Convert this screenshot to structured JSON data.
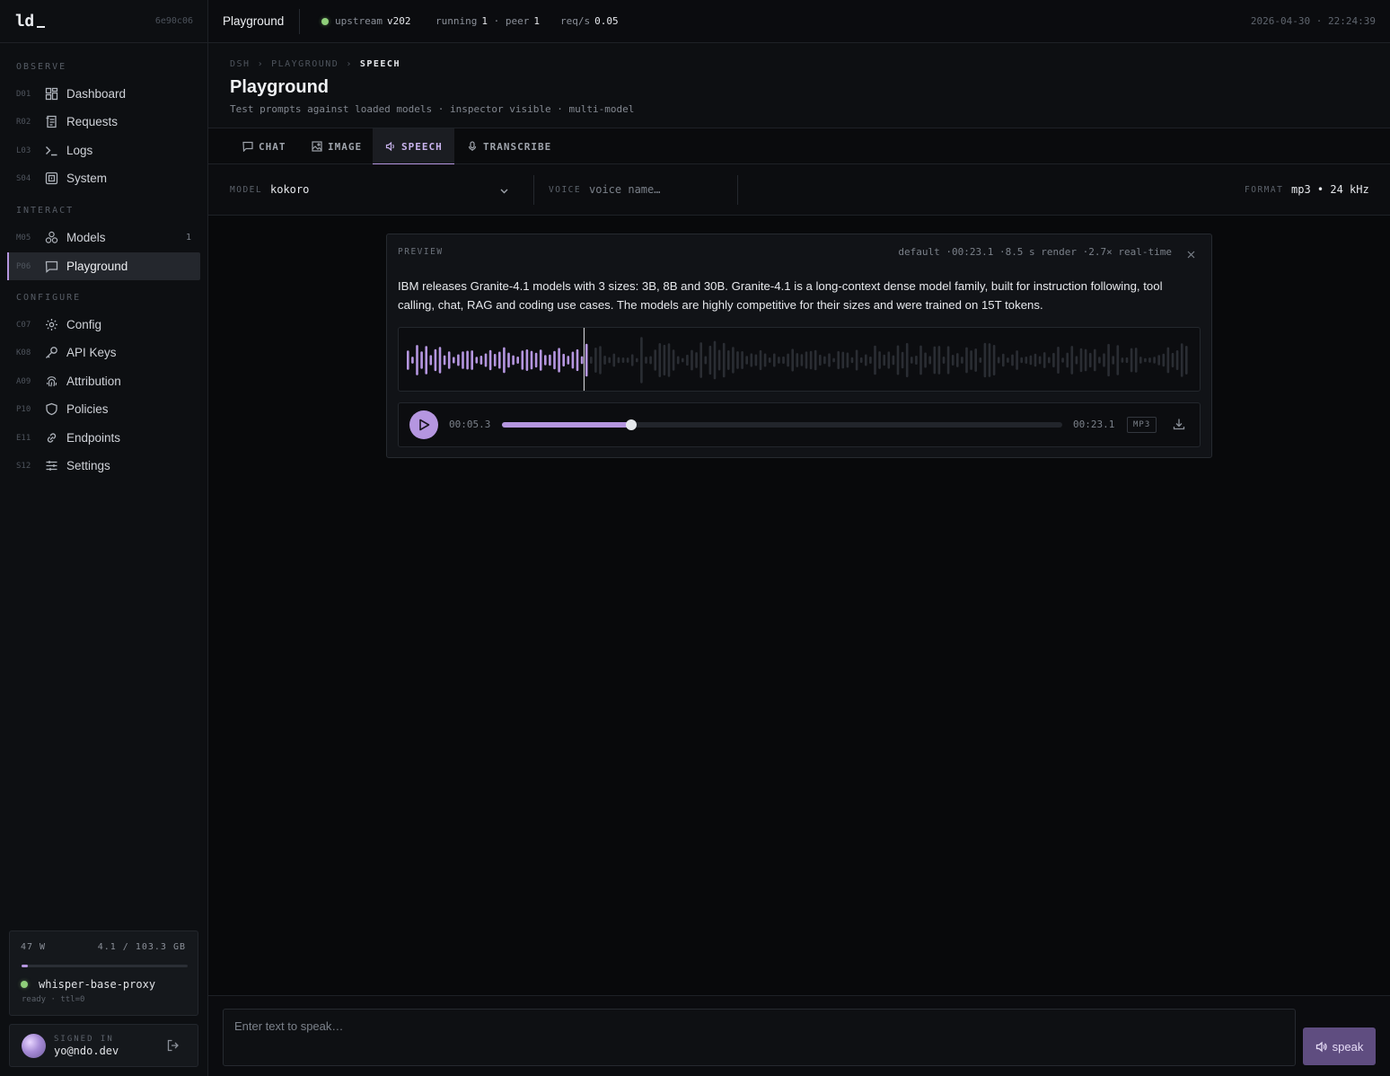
{
  "brand": {
    "logo": "ld",
    "hash": "6e90c06"
  },
  "sidebar": {
    "sections": [
      {
        "label": "OBSERVE",
        "items": [
          {
            "code": "D01",
            "icon": "dashboard-icon",
            "label": "Dashboard"
          },
          {
            "code": "R02",
            "icon": "requests-icon",
            "label": "Requests"
          },
          {
            "code": "L03",
            "icon": "terminal-icon",
            "label": "Logs"
          },
          {
            "code": "S04",
            "icon": "system-icon",
            "label": "System"
          }
        ]
      },
      {
        "label": "INTERACT",
        "items": [
          {
            "code": "M05",
            "icon": "models-icon",
            "label": "Models",
            "count": "1"
          },
          {
            "code": "P06",
            "icon": "chat-bubble-icon",
            "label": "Playground",
            "active": true
          }
        ]
      },
      {
        "label": "CONFIGURE",
        "items": [
          {
            "code": "C07",
            "icon": "gear-icon",
            "label": "Config"
          },
          {
            "code": "K08",
            "icon": "key-icon",
            "label": "API Keys"
          },
          {
            "code": "A09",
            "icon": "fingerprint-icon",
            "label": "Attribution"
          },
          {
            "code": "P10",
            "icon": "shield-icon",
            "label": "Policies"
          },
          {
            "code": "E11",
            "icon": "link-icon",
            "label": "Endpoints"
          },
          {
            "code": "S12",
            "icon": "sliders-icon",
            "label": "Settings"
          }
        ]
      }
    ]
  },
  "memory": {
    "power": "47 W",
    "usage": "4.1 / 103.3 GB",
    "used_fraction": 0.04,
    "model": "whisper-base-proxy",
    "status": "ready · ttl=0"
  },
  "user": {
    "label": "SIGNED IN",
    "email": "yo@ndo.dev"
  },
  "topbar": {
    "title": "Playground",
    "upstream_label": "upstream",
    "upstream_version": "v202",
    "running_label": "running",
    "running": "1",
    "peer_label": "· peer",
    "peer": "1",
    "reqs_label": "req/s",
    "reqs": "0.05",
    "timestamp": "2026-04-30 · 22:24:39"
  },
  "header": {
    "crumbs": [
      "DSH",
      "›",
      "PLAYGROUND",
      "›",
      "SPEECH"
    ],
    "title": "Playground",
    "subtitle": "Test prompts against loaded models · inspector visible · multi-model"
  },
  "tabs": [
    {
      "label": "CHAT",
      "icon": "chat-icon"
    },
    {
      "label": "IMAGE",
      "icon": "image-icon"
    },
    {
      "label": "SPEECH",
      "icon": "speaker-icon",
      "active": true
    },
    {
      "label": "TRANSCRIBE",
      "icon": "mic-icon"
    }
  ],
  "controls": {
    "model_label": "MODEL",
    "model_value": "kokoro",
    "voice_label": "VOICE",
    "voice_placeholder": "voice name…",
    "format_label": "FORMAT",
    "format_value": "mp3 • 24 kHz"
  },
  "preview": {
    "label": "PREVIEW",
    "meta": "default ·00:23.1 ·8.5 s render ·2.7× real-time",
    "text": "IBM releases Granite-4.1 models with 3 sizes: 3B, 8B and 30B. Granite-4.1 is a long-context dense model family, built for instruction following, tool calling, chat, RAG and coding use cases. The models are highly competitive for their sizes and were trained on 15T tokens.",
    "played_fraction": 0.23
  },
  "player": {
    "current": "00:05.3",
    "total": "00:23.1",
    "progress": 0.23,
    "format_badge": "MP3"
  },
  "composer": {
    "placeholder": "Enter text to speak…",
    "button_label": "speak"
  },
  "colors": {
    "accent": "#b596e0",
    "ok": "#8fcf7a",
    "bg": "#08090b"
  }
}
